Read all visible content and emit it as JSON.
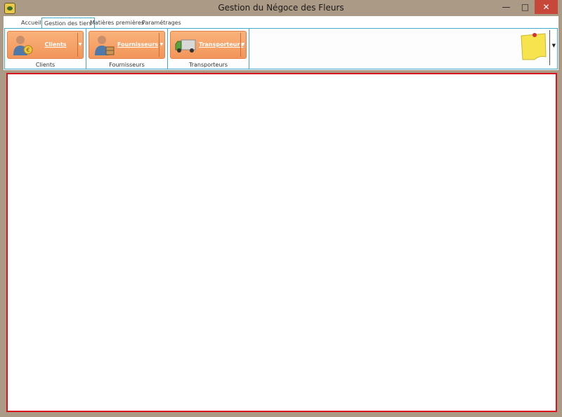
{
  "window": {
    "title": "Gestion du Négoce des Fleurs",
    "minimize_glyph": "—",
    "maximize_glyph": "□",
    "close_glyph": "✕"
  },
  "tabs": [
    {
      "label": "Accueil",
      "active": false
    },
    {
      "label": "Gestion des tiers",
      "active": true
    },
    {
      "label": "Matières premières",
      "active": false
    },
    {
      "label": "Paramétrages",
      "active": false
    }
  ],
  "groups": [
    {
      "button_label": "Clients",
      "group_label": "Clients",
      "icon": "client-icon"
    },
    {
      "button_label": "Fournisseurs",
      "group_label": "Fournisseurs",
      "icon": "supplier-icon"
    },
    {
      "button_label": "Transporteurs",
      "group_label": "Transporteurs",
      "icon": "truck-icon"
    }
  ],
  "dropdown_glyph": "▼",
  "colors": {
    "accent_border": "#44aacb",
    "button_orange": "#f2955a",
    "main_border": "#d8141e",
    "frame": "#ab9a86",
    "close_button": "#c7473b"
  }
}
